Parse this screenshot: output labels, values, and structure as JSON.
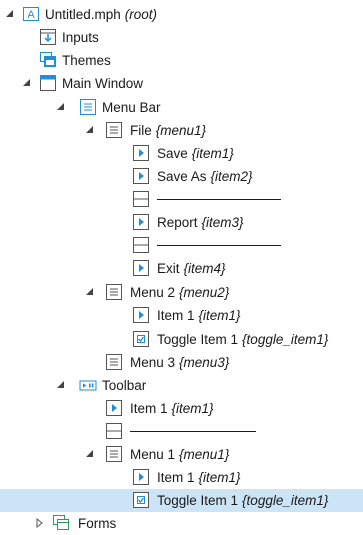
{
  "tree": {
    "root": {
      "label": "Untitled.mph",
      "tag": "(root)"
    },
    "inputs": {
      "label": "Inputs",
      "tag": ""
    },
    "themes": {
      "label": "Themes",
      "tag": ""
    },
    "main_window": {
      "label": "Main Window",
      "tag": ""
    },
    "menu_bar": {
      "label": "Menu Bar",
      "tag": ""
    },
    "file_menu": {
      "label": "File",
      "tag": "{menu1}"
    },
    "save": {
      "label": "Save",
      "tag": "{item1}"
    },
    "save_as": {
      "label": "Save As",
      "tag": "{item2}"
    },
    "report": {
      "label": "Report",
      "tag": "{item3}"
    },
    "exit": {
      "label": "Exit",
      "tag": "{item4}"
    },
    "menu2": {
      "label": "Menu 2",
      "tag": "{menu2}"
    },
    "menu2_item1": {
      "label": "Item 1",
      "tag": "{item1}"
    },
    "menu2_toggle": {
      "label": "Toggle Item 1",
      "tag": "{toggle_item1}"
    },
    "menu3": {
      "label": "Menu 3",
      "tag": "{menu3}"
    },
    "toolbar": {
      "label": "Toolbar",
      "tag": ""
    },
    "toolbar_item1": {
      "label": "Item 1",
      "tag": "{item1}"
    },
    "toolbar_menu1": {
      "label": "Menu 1",
      "tag": "{menu1}"
    },
    "toolbar_menu1_item1": {
      "label": "Item 1",
      "tag": "{item1}"
    },
    "toolbar_menu1_toggle": {
      "label": "Toggle Item 1",
      "tag": "{toggle_item1}"
    },
    "forms": {
      "label": "Forms",
      "tag": ""
    }
  },
  "colors": {
    "accent_blue": "#1f8fd6",
    "selection": "#cce4f7",
    "forms_green": "#2e9a5a"
  },
  "icons": {
    "expanded": "triangle-down-icon",
    "collapsed": "triangle-right-icon",
    "root": "app-a-icon",
    "inputs": "input-declaration-icon",
    "themes": "themes-icon",
    "window": "window-icon",
    "menu": "menu-icon",
    "item": "menu-item-icon",
    "separator": "separator-icon",
    "toggle": "toggle-item-icon",
    "toolbar": "toolbar-icon",
    "forms": "forms-icon"
  }
}
